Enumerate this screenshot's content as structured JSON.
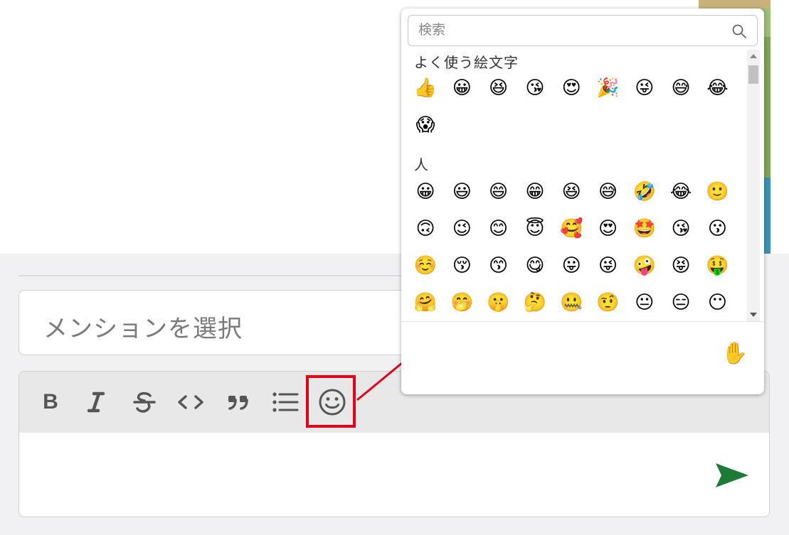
{
  "mention_select": {
    "placeholder": "メンションを選択"
  },
  "toolbar": {
    "buttons": [
      {
        "name": "bold-button",
        "icon": "bold-icon",
        "label": "B"
      },
      {
        "name": "italic-button",
        "icon": "italic-icon"
      },
      {
        "name": "strikethrough-button",
        "icon": "strikethrough-icon"
      },
      {
        "name": "code-button",
        "icon": "code-icon"
      },
      {
        "name": "quote-button",
        "icon": "quote-icon"
      },
      {
        "name": "list-button",
        "icon": "bulleted-list-icon"
      },
      {
        "name": "emoji-button",
        "icon": "smiley-icon"
      }
    ]
  },
  "send_button": {
    "icon": "send-arrow-icon",
    "color": "#1e7b35"
  },
  "annotation": {
    "color": "#e4001a"
  },
  "emoji_picker": {
    "search": {
      "placeholder": "検索",
      "icon": "search-icon"
    },
    "sections": [
      {
        "label": "よく使う絵文字",
        "emojis": [
          "👍",
          "😀",
          "😆",
          "😘",
          "😍",
          "🎉",
          "😜",
          "😅",
          "😂",
          "😱"
        ]
      },
      {
        "label": "人",
        "emojis": [
          "😀",
          "😃",
          "😄",
          "😁",
          "😆",
          "😅",
          "🤣",
          "😂",
          "🙂",
          "🙃",
          "😉",
          "😊",
          "😇",
          "🥰",
          "😍",
          "🤩",
          "😘",
          "😗",
          "☺️",
          "😚",
          "😙",
          "😋",
          "😛",
          "😜",
          "🤪",
          "😝",
          "🤑",
          "🤗",
          "🤭",
          "🤫",
          "🤔",
          "🤐",
          "🤨",
          "😐",
          "😑",
          "😶"
        ]
      }
    ],
    "preview_emoji": "✋"
  }
}
